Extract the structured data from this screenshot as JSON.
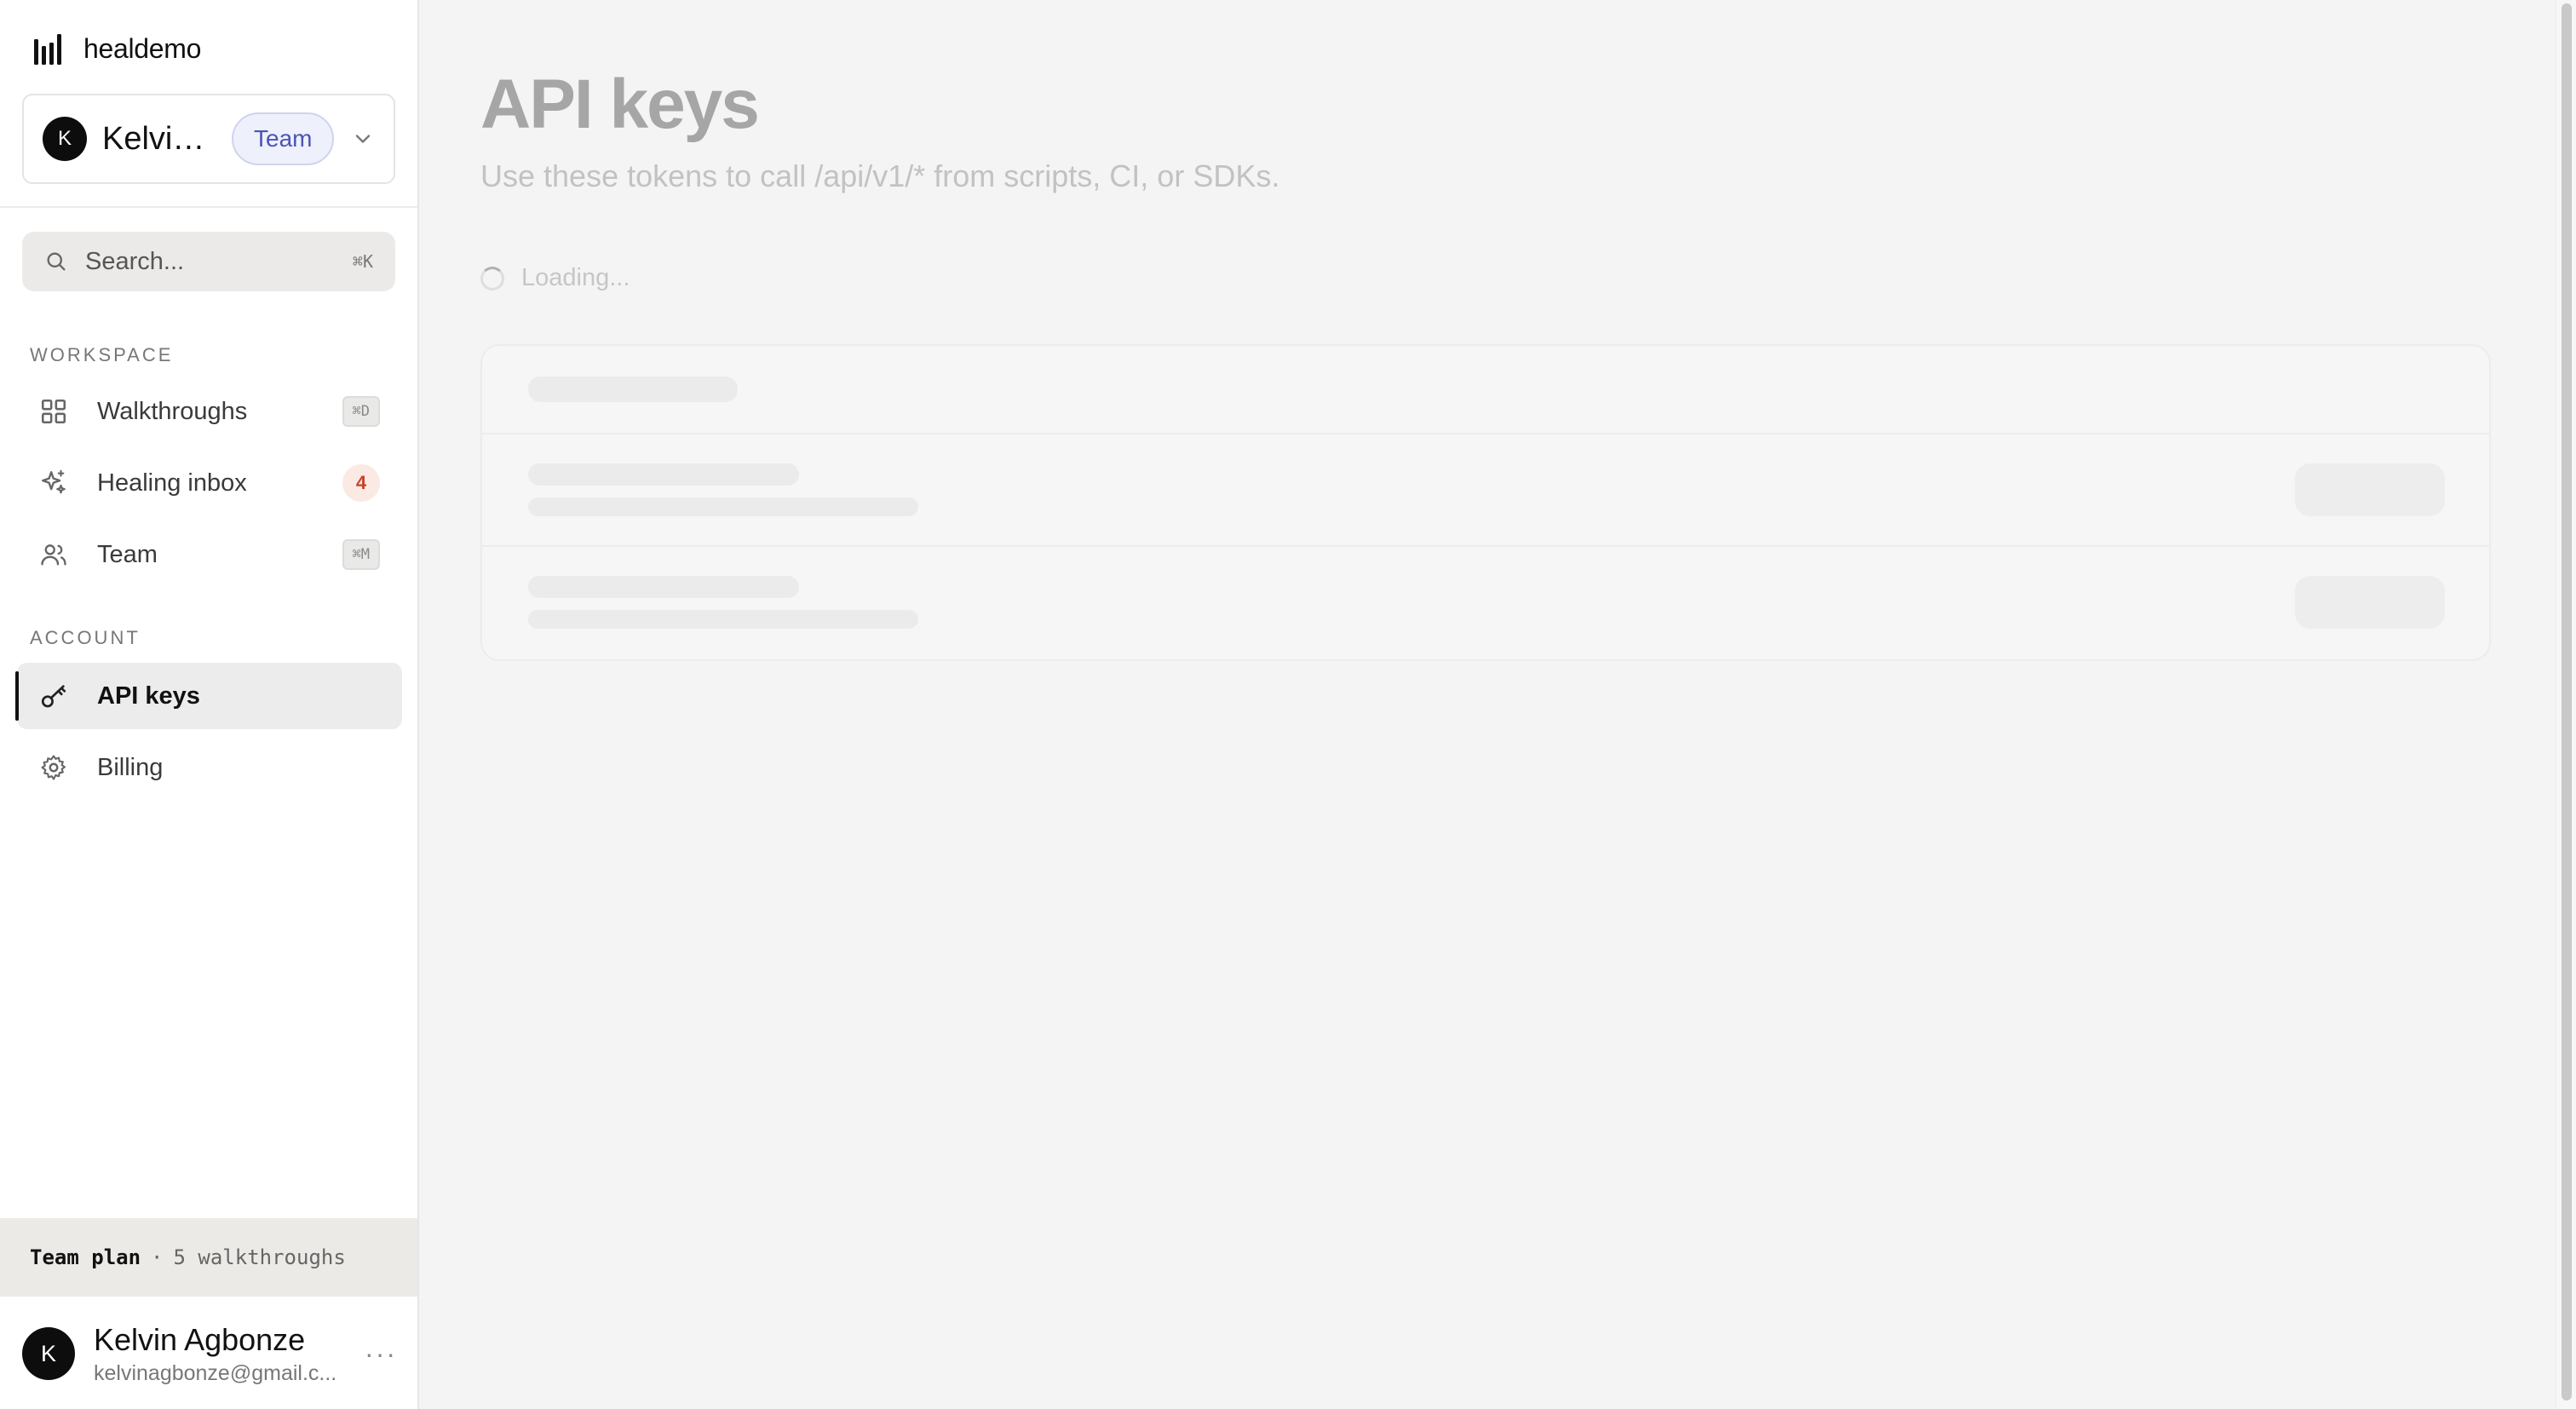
{
  "app": {
    "brand": "healdemo"
  },
  "workspace": {
    "avatar_initial": "K",
    "name": "Kelvin...",
    "plan_badge": "Team"
  },
  "search": {
    "placeholder": "Search...",
    "shortcut": "⌘K"
  },
  "sidebar": {
    "sections": [
      {
        "label": "WORKSPACE",
        "items": [
          {
            "label": "Walkthroughs",
            "icon": "grid-icon",
            "shortcut": "⌘D"
          },
          {
            "label": "Healing inbox",
            "icon": "sparkle-icon",
            "count": "4"
          },
          {
            "label": "Team",
            "icon": "users-icon",
            "shortcut": "⌘M"
          }
        ]
      },
      {
        "label": "ACCOUNT",
        "items": [
          {
            "label": "API keys",
            "icon": "key-icon",
            "active": true
          },
          {
            "label": "Billing",
            "icon": "gear-icon"
          }
        ]
      }
    ]
  },
  "plan": {
    "name": "Team plan",
    "separator": "·",
    "detail": "5 walkthroughs"
  },
  "user": {
    "avatar_initial": "K",
    "name": "Kelvin Agbonze",
    "email": "kelvinagbonze@gmail.c...",
    "menu": "···"
  },
  "page": {
    "title": "API keys",
    "subtitle": "Use these tokens to call /api/v1/* from scripts, CI, or SDKs.",
    "loading_text": "Loading..."
  },
  "colors": {
    "accent_badge_bg": "#eef0fb",
    "accent_badge_text": "#4a55b5",
    "count_badge_bg": "#fbe9e4",
    "count_badge_text": "#c4452b"
  }
}
